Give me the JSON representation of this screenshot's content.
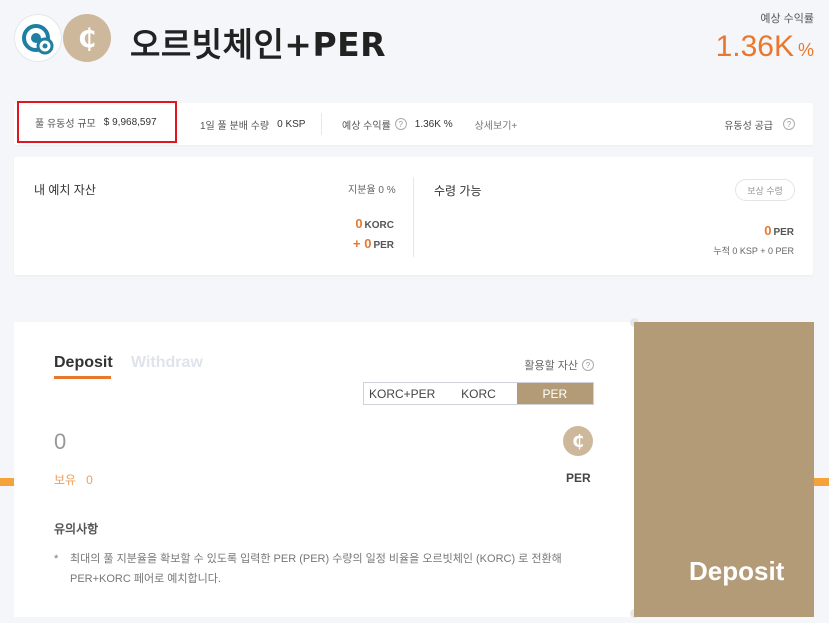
{
  "header": {
    "title": "오르빗체인+PER",
    "apr_label": "예상 수익률",
    "apr_value": "1.36K",
    "apr_unit": "%"
  },
  "stats": {
    "liquidity_label": "풀 유동성 규모",
    "liquidity_value": "$ 9,968,597",
    "daily_label": "1일 풀 분배 수량",
    "daily_value": "0 KSP",
    "apr_label": "예상 수익률",
    "apr_value": "1.36K %",
    "more_link": "상세보기+",
    "supply_label": "유동성 공급",
    "help_glyph": "?"
  },
  "my_deposit": {
    "title": "내 예치 자산",
    "share_label": "지분율 0 %",
    "amount1_value": "0",
    "amount1_token": "KORC",
    "amount2_value": "+ 0",
    "amount2_token": "PER",
    "claim_title": "수령 가능",
    "claim_button": "보상 수령",
    "claim_value": "0",
    "claim_token": "PER",
    "accumulated": "누적 0 KSP + 0 PER"
  },
  "deposit_panel": {
    "tab_deposit": "Deposit",
    "tab_withdraw": "Withdraw",
    "asset_label": "활용할 자산",
    "segments": [
      "KORC+PER",
      "KORC",
      "PER"
    ],
    "selected_segment": "PER",
    "amount": "0",
    "balance_label": "보유",
    "balance_value": "0",
    "token_label": "PER",
    "notice_title": "유의사항",
    "notice_bullet": "*",
    "notice_text": "최대의 풀 지분율을 확보할 수 있도록 입력한 PER (PER) 수량의 일정 비율을 오르빗체인 (KORC) 로 전환해 PER+KORC 페어로 예치합니다."
  },
  "deposit_button": "Deposit",
  "colors": {
    "accent": "#e8782d",
    "gold": "#b49b78",
    "highlight_box": "#e0151f"
  },
  "icons": {
    "coin_a": "orbit-chain-icon",
    "coin_b": "per-coin-icon"
  }
}
